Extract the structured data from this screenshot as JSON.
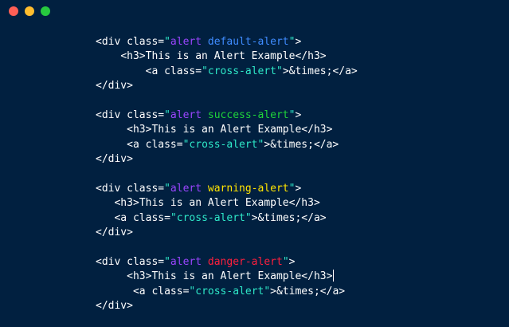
{
  "window": {
    "buttons": [
      {
        "name": "close",
        "color": "#ff5f56"
      },
      {
        "name": "minimize",
        "color": "#ffbd2e"
      },
      {
        "name": "maximize",
        "color": "#27c93f"
      }
    ]
  },
  "code": {
    "lines": [
      {
        "indent": "",
        "segments": [
          {
            "text": "<div class=",
            "kind": "plain"
          },
          {
            "text": "\"",
            "kind": "str"
          },
          {
            "text": "alert ",
            "kind": "alert"
          },
          {
            "text": "default-alert",
            "kind": "default"
          },
          {
            "text": "\"",
            "kind": "str"
          },
          {
            "text": ">",
            "kind": "plain"
          }
        ]
      },
      {
        "indent": "    ",
        "segments": [
          {
            "text": "<h3>This is an Alert Example</h3>",
            "kind": "plain"
          }
        ]
      },
      {
        "indent": "        ",
        "segments": [
          {
            "text": "<a class=",
            "kind": "plain"
          },
          {
            "text": "\"cross-alert\"",
            "kind": "str"
          },
          {
            "text": ">&times;</a>",
            "kind": "plain"
          }
        ]
      },
      {
        "indent": "",
        "segments": [
          {
            "text": "</div>",
            "kind": "plain"
          }
        ]
      },
      {
        "indent": "",
        "segments": []
      },
      {
        "indent": "",
        "segments": [
          {
            "text": "<div class=",
            "kind": "plain"
          },
          {
            "text": "\"",
            "kind": "str"
          },
          {
            "text": "alert ",
            "kind": "alert"
          },
          {
            "text": "success-alert",
            "kind": "success"
          },
          {
            "text": "\"",
            "kind": "str"
          },
          {
            "text": ">",
            "kind": "plain"
          }
        ]
      },
      {
        "indent": "     ",
        "segments": [
          {
            "text": "<h3>This is an Alert Example</h3>",
            "kind": "plain"
          }
        ]
      },
      {
        "indent": "     ",
        "segments": [
          {
            "text": "<a class=",
            "kind": "plain"
          },
          {
            "text": "\"cross-alert\"",
            "kind": "str"
          },
          {
            "text": ">&times;</a>",
            "kind": "plain"
          }
        ]
      },
      {
        "indent": "",
        "segments": [
          {
            "text": "</div>",
            "kind": "plain"
          }
        ]
      },
      {
        "indent": "",
        "segments": []
      },
      {
        "indent": "",
        "segments": [
          {
            "text": "<div class=",
            "kind": "plain"
          },
          {
            "text": "\"",
            "kind": "str"
          },
          {
            "text": "alert ",
            "kind": "alert"
          },
          {
            "text": "warning-alert",
            "kind": "warning"
          },
          {
            "text": "\"",
            "kind": "str"
          },
          {
            "text": ">",
            "kind": "plain"
          }
        ]
      },
      {
        "indent": "   ",
        "segments": [
          {
            "text": "<h3>This is an Alert Example</h3>",
            "kind": "plain"
          }
        ]
      },
      {
        "indent": "   ",
        "segments": [
          {
            "text": "<a class=",
            "kind": "plain"
          },
          {
            "text": "\"cross-alert\"",
            "kind": "str"
          },
          {
            "text": ">&times;</a>",
            "kind": "plain"
          }
        ]
      },
      {
        "indent": "",
        "segments": [
          {
            "text": "</div>",
            "kind": "plain"
          }
        ]
      },
      {
        "indent": "",
        "segments": []
      },
      {
        "indent": "",
        "segments": [
          {
            "text": "<div class=",
            "kind": "plain"
          },
          {
            "text": "\"",
            "kind": "str"
          },
          {
            "text": "alert ",
            "kind": "alert"
          },
          {
            "text": "danger-alert",
            "kind": "danger"
          },
          {
            "text": "\"",
            "kind": "str"
          },
          {
            "text": ">",
            "kind": "plain"
          }
        ]
      },
      {
        "indent": "     ",
        "segments": [
          {
            "text": "<h3>This is an Alert Example</h3>",
            "kind": "plain"
          }
        ],
        "cursor": true
      },
      {
        "indent": "      ",
        "segments": [
          {
            "text": "<a class=",
            "kind": "plain"
          },
          {
            "text": "\"cross-alert\"",
            "kind": "str"
          },
          {
            "text": ">&times;</a>",
            "kind": "plain"
          }
        ]
      },
      {
        "indent": "",
        "segments": [
          {
            "text": "</div>",
            "kind": "plain"
          }
        ]
      }
    ]
  }
}
